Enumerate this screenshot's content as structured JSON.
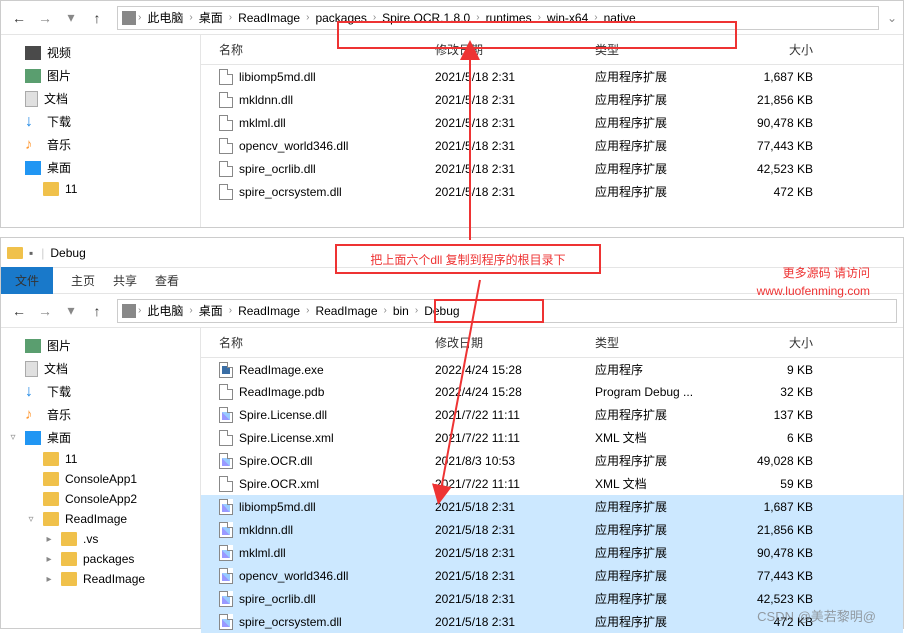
{
  "window1": {
    "breadcrumbs": [
      "此电脑",
      "桌面",
      "ReadImage",
      "packages",
      "Spire.OCR.1.8.0",
      "runtimes",
      "win-x64",
      "native"
    ],
    "tree": [
      {
        "icon": "ic-video",
        "label": "视频",
        "exp": ""
      },
      {
        "icon": "ic-pic",
        "label": "图片",
        "exp": ""
      },
      {
        "icon": "ic-doc",
        "label": "文档",
        "exp": ""
      },
      {
        "icon": "ic-dl",
        "label": "下载",
        "exp": "",
        "glyph": "↓"
      },
      {
        "icon": "ic-music",
        "label": "音乐",
        "exp": "",
        "glyph": "♪"
      },
      {
        "icon": "ic-desk",
        "label": "桌面",
        "exp": ""
      },
      {
        "icon": "ic-folder",
        "label": "11",
        "exp": "",
        "indent": "indent1"
      }
    ],
    "columns": {
      "name": "名称",
      "date": "修改日期",
      "type": "类型",
      "size": "大小"
    },
    "files": [
      {
        "name": "libiomp5md.dll",
        "date": "2021/5/18 2:31",
        "type": "应用程序扩展",
        "size": "1,687 KB"
      },
      {
        "name": "mkldnn.dll",
        "date": "2021/5/18 2:31",
        "type": "应用程序扩展",
        "size": "21,856 KB"
      },
      {
        "name": "mklml.dll",
        "date": "2021/5/18 2:31",
        "type": "应用程序扩展",
        "size": "90,478 KB"
      },
      {
        "name": "opencv_world346.dll",
        "date": "2021/5/18 2:31",
        "type": "应用程序扩展",
        "size": "77,443 KB"
      },
      {
        "name": "spire_ocrlib.dll",
        "date": "2021/5/18 2:31",
        "type": "应用程序扩展",
        "size": "42,523 KB"
      },
      {
        "name": "spire_ocrsystem.dll",
        "date": "2021/5/18 2:31",
        "type": "应用程序扩展",
        "size": "472 KB"
      }
    ]
  },
  "window2": {
    "title": "Debug",
    "menus": {
      "file": "文件",
      "home": "主页",
      "share": "共享",
      "view": "查看"
    },
    "breadcrumbs": [
      "此电脑",
      "桌面",
      "ReadImage",
      "ReadImage",
      "bin",
      "Debug"
    ],
    "tree": [
      {
        "icon": "ic-pic",
        "label": "图片",
        "exp": ""
      },
      {
        "icon": "ic-doc",
        "label": "文档",
        "exp": ""
      },
      {
        "icon": "ic-dl",
        "label": "下载",
        "exp": "",
        "glyph": "↓"
      },
      {
        "icon": "ic-music",
        "label": "音乐",
        "exp": "",
        "glyph": "♪"
      },
      {
        "icon": "ic-desk",
        "label": "桌面",
        "exp": "▿"
      },
      {
        "icon": "ic-folder",
        "label": "11",
        "exp": "",
        "indent": "indent1"
      },
      {
        "icon": "ic-folder",
        "label": "ConsoleApp1",
        "exp": "",
        "indent": "indent1"
      },
      {
        "icon": "ic-folder",
        "label": "ConsoleApp2",
        "exp": "",
        "indent": "indent1"
      },
      {
        "icon": "ic-folder",
        "label": "ReadImage",
        "exp": "▿",
        "indent": "indent1"
      },
      {
        "icon": "ic-folder",
        "label": ".vs",
        "exp": "▸",
        "indent": "indent2"
      },
      {
        "icon": "ic-folder",
        "label": "packages",
        "exp": "▸",
        "indent": "indent2"
      },
      {
        "icon": "ic-folder",
        "label": "ReadImage",
        "exp": "▸",
        "indent": "indent2"
      }
    ],
    "columns": {
      "name": "名称",
      "date": "修改日期",
      "type": "类型",
      "size": "大小"
    },
    "files": [
      {
        "name": "ReadImage.exe",
        "date": "2022/4/24 15:28",
        "type": "应用程序",
        "size": "9 KB",
        "ic": "exe"
      },
      {
        "name": "ReadImage.pdb",
        "date": "2022/4/24 15:28",
        "type": "Program Debug ...",
        "size": "32 KB"
      },
      {
        "name": "Spire.License.dll",
        "date": "2021/7/22 11:11",
        "type": "应用程序扩展",
        "size": "137 KB",
        "ic": "dll"
      },
      {
        "name": "Spire.License.xml",
        "date": "2021/7/22 11:11",
        "type": "XML 文档",
        "size": "6 KB"
      },
      {
        "name": "Spire.OCR.dll",
        "date": "2021/8/3 10:53",
        "type": "应用程序扩展",
        "size": "49,028 KB",
        "ic": "dll"
      },
      {
        "name": "Spire.OCR.xml",
        "date": "2021/7/22 11:11",
        "type": "XML 文档",
        "size": "59 KB"
      },
      {
        "name": "libiomp5md.dll",
        "date": "2021/5/18 2:31",
        "type": "应用程序扩展",
        "size": "1,687 KB",
        "sel": true,
        "ic": "dll"
      },
      {
        "name": "mkldnn.dll",
        "date": "2021/5/18 2:31",
        "type": "应用程序扩展",
        "size": "21,856 KB",
        "sel": true,
        "ic": "dll"
      },
      {
        "name": "mklml.dll",
        "date": "2021/5/18 2:31",
        "type": "应用程序扩展",
        "size": "90,478 KB",
        "sel": true,
        "ic": "dll"
      },
      {
        "name": "opencv_world346.dll",
        "date": "2021/5/18 2:31",
        "type": "应用程序扩展",
        "size": "77,443 KB",
        "sel": true,
        "ic": "dll"
      },
      {
        "name": "spire_ocrlib.dll",
        "date": "2021/5/18 2:31",
        "type": "应用程序扩展",
        "size": "42,523 KB",
        "sel": true,
        "ic": "dll"
      },
      {
        "name": "spire_ocrsystem.dll",
        "date": "2021/5/18 2:31",
        "type": "应用程序扩展",
        "size": "472 KB",
        "sel": true,
        "ic": "dll"
      }
    ]
  },
  "annotations": {
    "instruction": "把上面六个dll 复制到程序的根目录下",
    "promo1": "更多源码 请访问",
    "promo2": "www.luofenming.com"
  },
  "watermark": "CSDN @美若黎明@"
}
